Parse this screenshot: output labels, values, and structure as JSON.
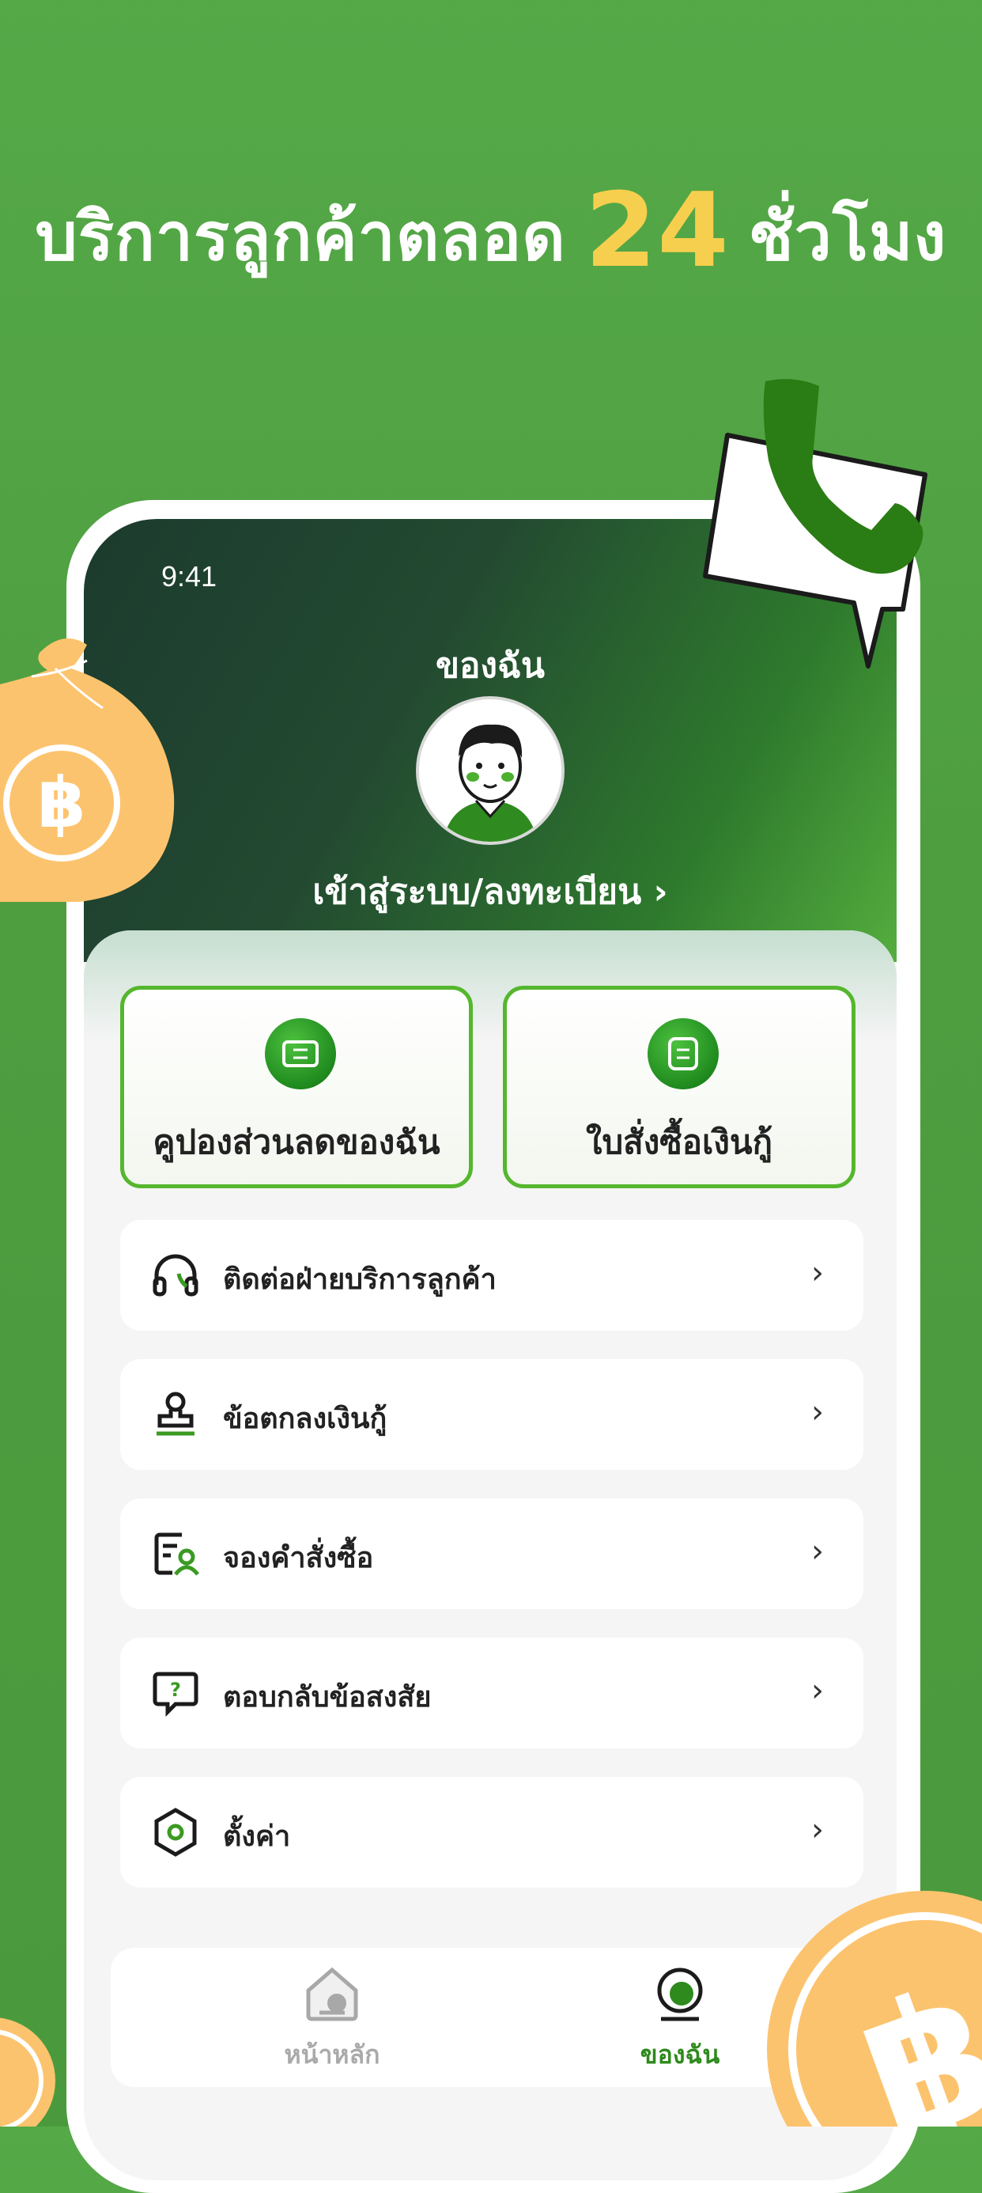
{
  "headline": {
    "part1": "บริการลูกค้าตลอด",
    "number": "24",
    "part2": "ชั่วโมง"
  },
  "status_bar": {
    "time": "9:41"
  },
  "header": {
    "title": "ของฉัน",
    "login_link": "เข้าสู่ระบบ/ลงทะเบียน",
    "login_chevron": "›"
  },
  "quick_actions": [
    {
      "label": "คูปองส่วนลดของฉัน",
      "icon": "coupon-icon"
    },
    {
      "label": "ใบสั่งซื้อเงินกู้",
      "icon": "document-icon"
    }
  ],
  "menu": [
    {
      "label": "ติดต่อฝ่ายบริการลูกค้า",
      "icon": "headset-icon"
    },
    {
      "label": "ข้อตกลงเงินกู้",
      "icon": "stamp-icon"
    },
    {
      "label": "จองคำสั่งซื้อ",
      "icon": "order-user-icon"
    },
    {
      "label": "ตอบกลับข้อสงสัย",
      "icon": "question-chat-icon"
    },
    {
      "label": "ตั้งค่า",
      "icon": "settings-icon"
    }
  ],
  "menu_chevron": "›",
  "tabbar": {
    "home_label": "หน้าหลัก",
    "mine_label": "ของฉัน"
  },
  "colors": {
    "background_green": "#4e9e40",
    "accent_green": "#2e8a1c",
    "highlight_yellow": "#f7cf4e",
    "coin_orange": "#fcc36e"
  }
}
